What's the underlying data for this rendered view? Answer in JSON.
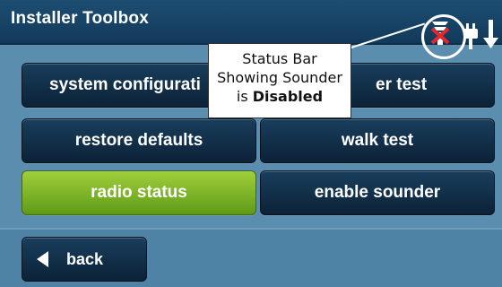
{
  "header": {
    "title": "Installer Toolbox",
    "status_icons": [
      "sounder-disabled-icon",
      "power-plug-icon",
      "arrow-down-icon"
    ]
  },
  "tiles": {
    "system_configuration": "system configurati",
    "speaker_test": "er test",
    "restore_defaults": "restore defaults",
    "walk_test": "walk test",
    "radio_status": "radio status",
    "enable_sounder": "enable sounder"
  },
  "footer": {
    "back_label": "back"
  },
  "callout": {
    "line1": "Status Bar",
    "line2": "Showing Sounder",
    "line3_prefix": "is ",
    "line3_bold": "Disabled"
  },
  "colors": {
    "background": "#5b8dae",
    "header": "#1d4e72",
    "tile": "#12324d",
    "tile_active": "#8cc43a",
    "disabled_x": "#e0282e"
  }
}
